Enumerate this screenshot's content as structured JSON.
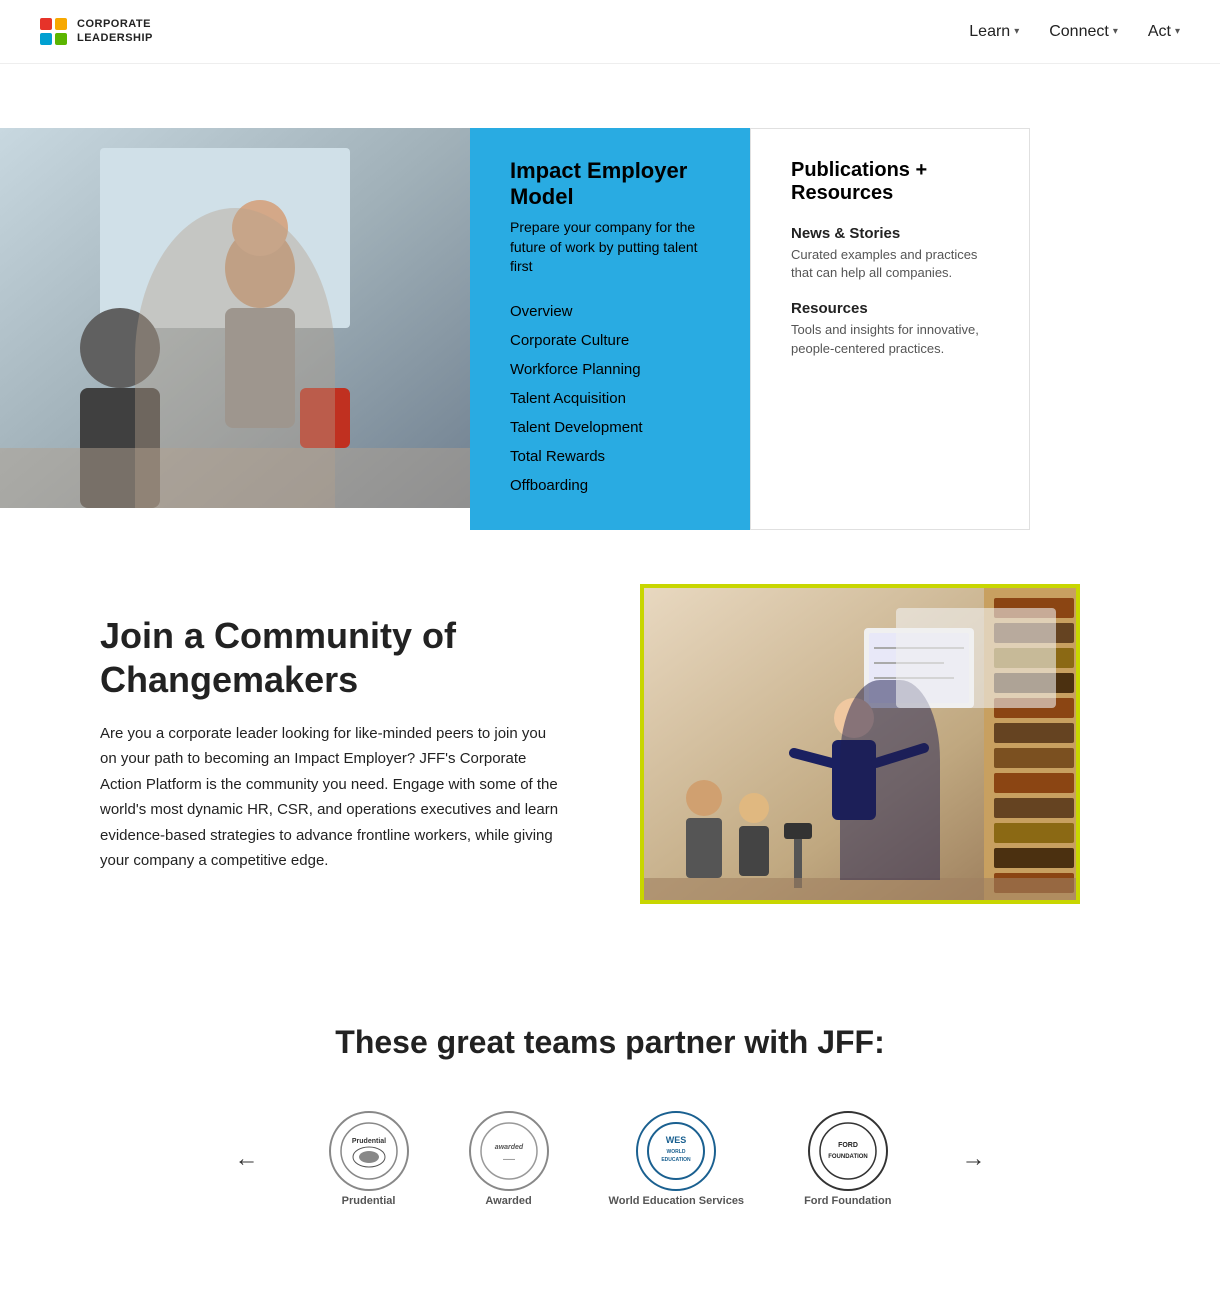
{
  "nav": {
    "logo_line1": "CORPORATE",
    "logo_line2": "LEADERSHIP",
    "items": [
      {
        "label": "Learn",
        "id": "learn"
      },
      {
        "label": "Connect",
        "id": "connect"
      },
      {
        "label": "Act",
        "id": "act"
      }
    ]
  },
  "dropdown": {
    "heading": "Impact Employer Model",
    "subtitle": "Prepare your company for the future of work by putting talent first",
    "menu_items": [
      "Overview",
      "Corporate Culture",
      "Workforce Planning",
      "Talent Acquisition",
      "Talent Development",
      "Total Rewards",
      "Offboarding"
    ],
    "publications_heading": "Publications + Resources",
    "publications": [
      {
        "title": "News & Stories",
        "desc": "Curated examples and practices that can help all companies."
      },
      {
        "title": "Resources",
        "desc": "Tools and insights for innovative, people-centered practices."
      }
    ]
  },
  "community": {
    "heading_line1": "Join a Community of",
    "heading_line2": "Changemakers",
    "body": "Are you a corporate leader looking for like-minded peers to join you on your path to becoming an Impact Employer? JFF's Corporate Action Platform is the community you need. Engage with some of the world's most dynamic HR, CSR, and operations executives and learn evidence-based strategies to advance frontline workers, while giving your company a competitive edge."
  },
  "partners": {
    "heading": "These great teams partner with JFF:",
    "logos": [
      {
        "name": "Prudential",
        "abbr": "Prudential"
      },
      {
        "name": "Awarded",
        "abbr": "awarded"
      },
      {
        "name": "World Education Services",
        "abbr": "WES\nWORLD\nEDUCATION"
      },
      {
        "name": "Ford Foundation",
        "abbr": "FORD\nFOUNDATION"
      }
    ],
    "prev_label": "←",
    "next_label": "→"
  }
}
